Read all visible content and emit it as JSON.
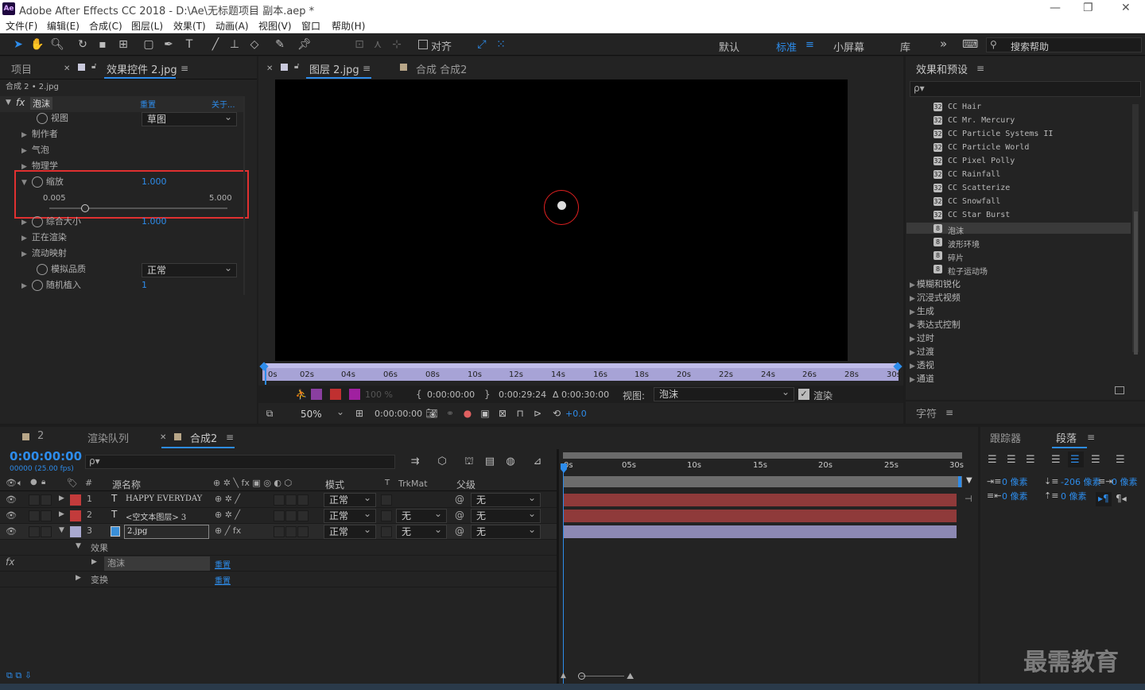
{
  "window": {
    "app_logo": "Ae",
    "title": "Adobe After Effects CC 2018 - D:\\Ae\\无标题项目 副本.aep *",
    "minimize": "—",
    "restore": "❐",
    "close": "✕"
  },
  "menu": [
    "文件(F)",
    "编辑(E)",
    "合成(C)",
    "图层(L)",
    "效果(T)",
    "动画(A)",
    "视图(V)",
    "窗口",
    "帮助(H)"
  ],
  "toolbar": {
    "align_label": "对齐",
    "workspaces": [
      "默认",
      "标准",
      "小屏幕",
      "库"
    ],
    "active_workspace": "标准",
    "more": "»",
    "search_help": "搜索帮助"
  },
  "left_panel": {
    "tabs": [
      "项目",
      "效果控件 2.jpg"
    ],
    "source_line": "合成 2 • 2.jpg",
    "effect": {
      "fx": "fx",
      "name": "泡沫",
      "reset": "重置",
      "about": "关于..."
    },
    "props": [
      {
        "label": "视图",
        "value": "草图"
      },
      {
        "label": "制作者"
      },
      {
        "label": "气泡"
      },
      {
        "label": "物理学"
      },
      {
        "label": "缩放",
        "value": "1.000"
      },
      {
        "label": "综合大小",
        "value": "1.000"
      },
      {
        "label": "正在渲染"
      },
      {
        "label": "流动映射"
      },
      {
        "label": "模拟品质",
        "value": "正常"
      },
      {
        "label": "随机植入",
        "value": "1"
      }
    ],
    "slider": {
      "min": "0.005",
      "max": "5.000",
      "value": 1.0,
      "range_min": 0.005,
      "range_max": 5.0
    }
  },
  "viewer": {
    "tabs": [
      "图层 2.jpg",
      "合成 合成2"
    ],
    "ruler": [
      "0s",
      "02s",
      "04s",
      "06s",
      "08s",
      "10s",
      "12s",
      "14s",
      "16s",
      "18s",
      "20s",
      "22s",
      "24s",
      "26s",
      "28s",
      "30s"
    ],
    "opacity": "100 %",
    "time_in": "0:00:00:00",
    "time_out": "0:00:29:24",
    "duration": "Δ 0:00:30:00",
    "view_label": "视图:",
    "view_value": "泡沫",
    "render_label": "渲染",
    "zoom": "50%",
    "timecode": "0:00:00:00",
    "exposure": "+0.0"
  },
  "effects_panel": {
    "title": "效果和预设",
    "search_placeholder": "ρ▾",
    "items": [
      "CC Hair",
      "CC Mr. Mercury",
      "CC Particle Systems II",
      "CC Particle World",
      "CC Pixel Polly",
      "CC Rainfall",
      "CC Scatterize",
      "CC Snowfall",
      "CC Star Burst",
      "泡沫",
      "波形环境",
      "碎片",
      "粒子运动场"
    ],
    "selected": "泡沫",
    "categories": [
      "模糊和锐化",
      "沉浸式视频",
      "生成",
      "表达式控制",
      "过时",
      "过渡",
      "透视",
      "通道"
    ]
  },
  "char_panel": {
    "title": "字符"
  },
  "timeline": {
    "tabs": [
      "2",
      "渲染队列",
      "合成2"
    ],
    "timecode": "0:00:00:00",
    "fps": "00000 (25.00 fps)",
    "search_placeholder": "ρ▾",
    "columns": {
      "source": "源名称",
      "mode": "模式",
      "t": "T",
      "trkmat": "TrkMat",
      "parent": "父级"
    },
    "layers": [
      {
        "num": "1",
        "type": "T",
        "name": "HAPPY EVERYDAY",
        "mode": "正常",
        "trkmat": "",
        "parent": "无",
        "color": "#c23b3b"
      },
      {
        "num": "2",
        "type": "T",
        "name": "<空文本图层> 3",
        "mode": "正常",
        "trkmat": "无",
        "parent": "无",
        "color": "#c23b3b"
      },
      {
        "num": "3",
        "type": "img",
        "name": "2.jpg",
        "mode": "正常",
        "trkmat": "无",
        "parent": "无",
        "color": "#a9a9d0"
      }
    ],
    "sub_rows": [
      {
        "label": "效果"
      },
      {
        "label": "泡沫",
        "reset": "重置"
      },
      {
        "label": "变换",
        "reset": "重置"
      }
    ],
    "ruler": [
      "0s",
      "05s",
      "10s",
      "15s",
      "20s",
      "25s",
      "30s"
    ]
  },
  "right_bottom": {
    "tabs": [
      "跟踪器",
      "段落"
    ],
    "indent": [
      {
        "value": "0 像素"
      },
      {
        "value": "-206 像素"
      },
      {
        "value": "0 像素"
      },
      {
        "value": "0 像素"
      },
      {
        "value": "0 像素"
      }
    ]
  },
  "watermark": "最需教育"
}
